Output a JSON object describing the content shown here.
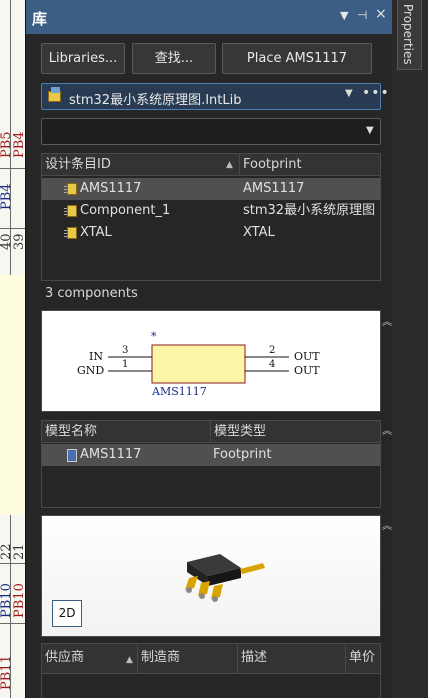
{
  "schematic": {
    "top_labels": [
      "PB5",
      "PB4",
      "40",
      "39"
    ],
    "bottom_labels": [
      "22",
      "21",
      "PB10",
      "PB11"
    ]
  },
  "panel": {
    "title": "库",
    "title_icons": [
      "chevron-down-icon",
      "pin-icon",
      "close-icon"
    ]
  },
  "toolbar": {
    "libraries_label": "Libraries...",
    "search_label": "查找...",
    "place_label": "Place AMS1117"
  },
  "library_select": {
    "value": "stm32最小系统原理图.IntLib",
    "icon": "library-icon"
  },
  "filter_select": {
    "value": ""
  },
  "components": {
    "headers": [
      "设计条目ID",
      "Footprint"
    ],
    "rows": [
      {
        "id": "AMS1117",
        "footprint": "AMS1117",
        "selected": true
      },
      {
        "id": "Component_1",
        "footprint": "stm32最小系统原理图",
        "selected": false
      },
      {
        "id": "XTAL",
        "footprint": "XTAL",
        "selected": false
      }
    ],
    "count_text": "3 components"
  },
  "symbol": {
    "designator": "*",
    "name": "AMS1117",
    "pins_left": [
      {
        "label": "IN",
        "number": "3"
      },
      {
        "label": "GND",
        "number": "1"
      }
    ],
    "pins_right": [
      {
        "label": "OUT",
        "number": "2"
      },
      {
        "label": "OUT",
        "number": "4"
      }
    ],
    "fill_color": "#fdf5a8",
    "border_color": "#8a1a1a"
  },
  "models": {
    "headers": [
      "模型名称",
      "模型类型"
    ],
    "rows": [
      {
        "name": "AMS1117",
        "type": "Footprint",
        "selected": true
      }
    ]
  },
  "model_preview": {
    "mode_button": "2D"
  },
  "suppliers": {
    "headers": [
      "供应商",
      "制造商",
      "描述",
      "单价"
    ]
  },
  "properties_tab": {
    "label": "Properties"
  },
  "colors": {
    "titlebar": "#3c5d84",
    "panel_bg": "#262626",
    "selected_row": "#505050",
    "accent_border": "#4d7fb0"
  }
}
